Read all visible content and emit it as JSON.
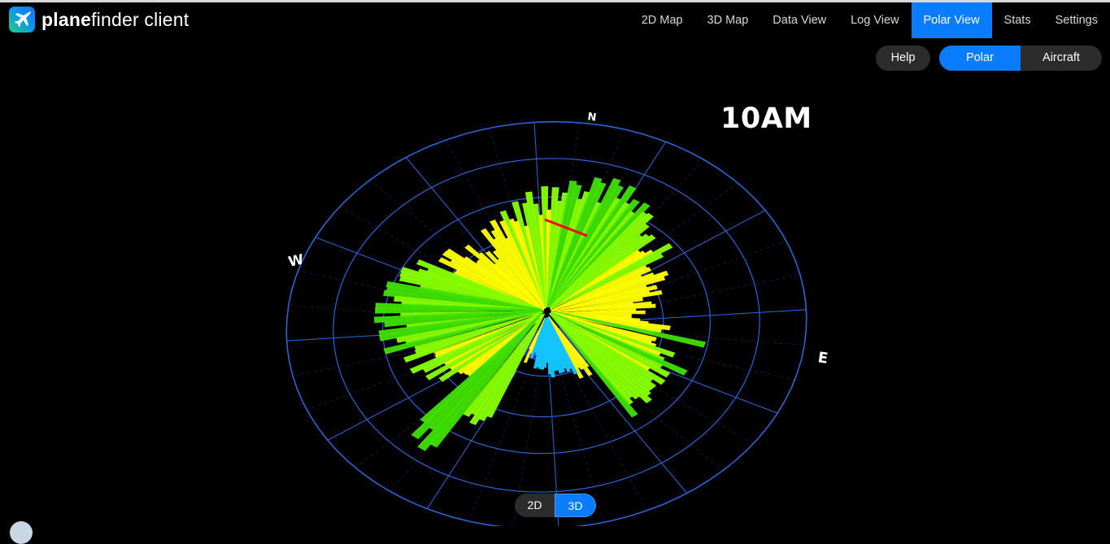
{
  "app": {
    "brand_bold": "plane",
    "brand_light": "finder client"
  },
  "nav": {
    "items": [
      {
        "label": "2D Map",
        "active": false
      },
      {
        "label": "3D Map",
        "active": false
      },
      {
        "label": "Data View",
        "active": false
      },
      {
        "label": "Log View",
        "active": false
      },
      {
        "label": "Polar View",
        "active": true
      },
      {
        "label": "Stats",
        "active": false
      },
      {
        "label": "Settings",
        "active": false
      }
    ]
  },
  "controls": {
    "help_label": "Help",
    "mode_options": [
      {
        "label": "Polar",
        "active": true
      },
      {
        "label": "Aircraft",
        "active": false
      }
    ],
    "dimension_options": [
      {
        "label": "2D",
        "active": false
      },
      {
        "label": "3D",
        "active": true
      }
    ]
  },
  "polar": {
    "time_label": "10AM",
    "compass": {
      "north": "N",
      "east": "E",
      "west": "W"
    },
    "colors": {
      "accent": "#0a7cff",
      "grid": "#2f63d6",
      "near": "#ffff00",
      "mid": "#88ff00",
      "far": "#3fe000",
      "low": "#14c8ff",
      "lowest": "#3a3af0",
      "heading": "#ff0000"
    }
  }
}
